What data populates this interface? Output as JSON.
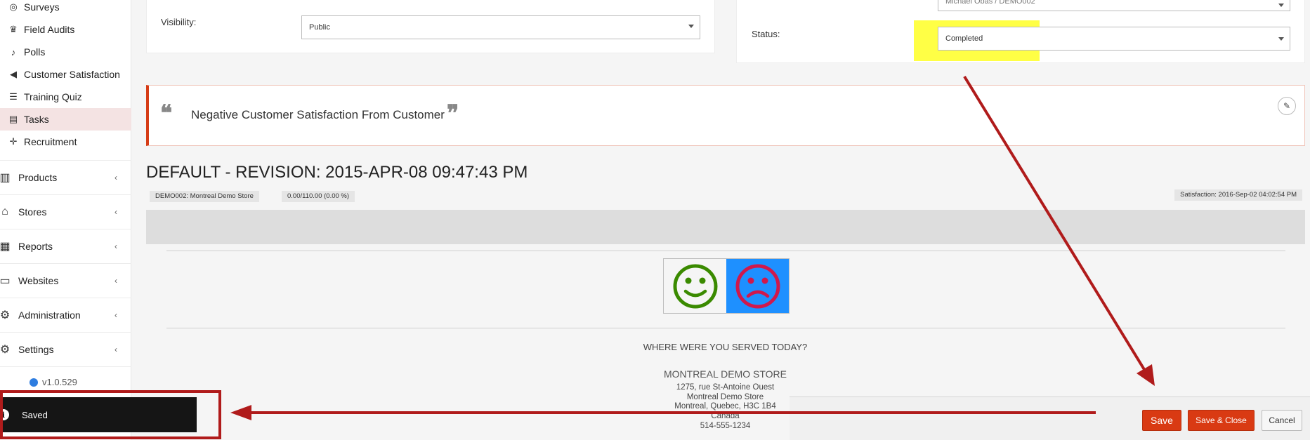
{
  "sidebar": {
    "items": [
      {
        "label": "Surveys",
        "icon": "target-icon"
      },
      {
        "label": "Field Audits",
        "icon": "trophy-icon"
      },
      {
        "label": "Polls",
        "icon": "bell-icon"
      },
      {
        "label": "Customer Satisfaction",
        "icon": "megaphone-icon"
      },
      {
        "label": "Training Quiz",
        "icon": "list-icon"
      },
      {
        "label": "Tasks",
        "icon": "tasks-icon"
      },
      {
        "label": "Recruitment",
        "icon": "crosshair-icon"
      }
    ],
    "groups": [
      {
        "label": "Products",
        "icon": "barcode-icon"
      },
      {
        "label": "Stores",
        "icon": "bank-icon"
      },
      {
        "label": "Reports",
        "icon": "calculator-icon"
      },
      {
        "label": "Websites",
        "icon": "desktop-icon"
      },
      {
        "label": "Administration",
        "icon": "gears-icon"
      },
      {
        "label": "Settings",
        "icon": "gear-icon"
      }
    ],
    "version": "v1.0.529"
  },
  "form": {
    "visibility_label": "Visibility:",
    "visibility_value": "Public",
    "assignee_value": "Michael Obas / DEMO002",
    "status_label": "Status:",
    "status_value": "Completed"
  },
  "quote": {
    "open_mark": "❝",
    "close_mark": "❞",
    "text": "Negative Customer Satisfaction From Customer",
    "edit_icon": "✎"
  },
  "revision": {
    "title": "DEFAULT - REVISION: 2015-APR-08 09:47:43 PM",
    "store_tag": "DEMO002: Montreal Demo Store",
    "score_tag": "0.00/110.00 (0.00 %)",
    "satisfaction_tag": "Satisfaction: 2016-Sep-02 04:02:54 PM"
  },
  "survey": {
    "question": "WHERE WERE YOU SERVED TODAY?",
    "store_name": "MONTREAL DEMO STORE",
    "address_lines": [
      "1275, rue St-Antoine Ouest",
      "Montreal Demo Store",
      "Montreal, Quebec, H3C 1B4",
      "Canada",
      "514-555-1234"
    ]
  },
  "actions": {
    "save": "Save",
    "save_close": "Save & Close",
    "cancel": "Cancel"
  },
  "toast": {
    "info_icon": "i",
    "message": "Saved"
  },
  "colors": {
    "accent": "#d93a13",
    "highlight": "#ffff45",
    "annotation": "#b01b1b",
    "happy_face": "#3a8a00",
    "sad_face": "#d0184c",
    "sad_bg": "#1e90ff"
  }
}
